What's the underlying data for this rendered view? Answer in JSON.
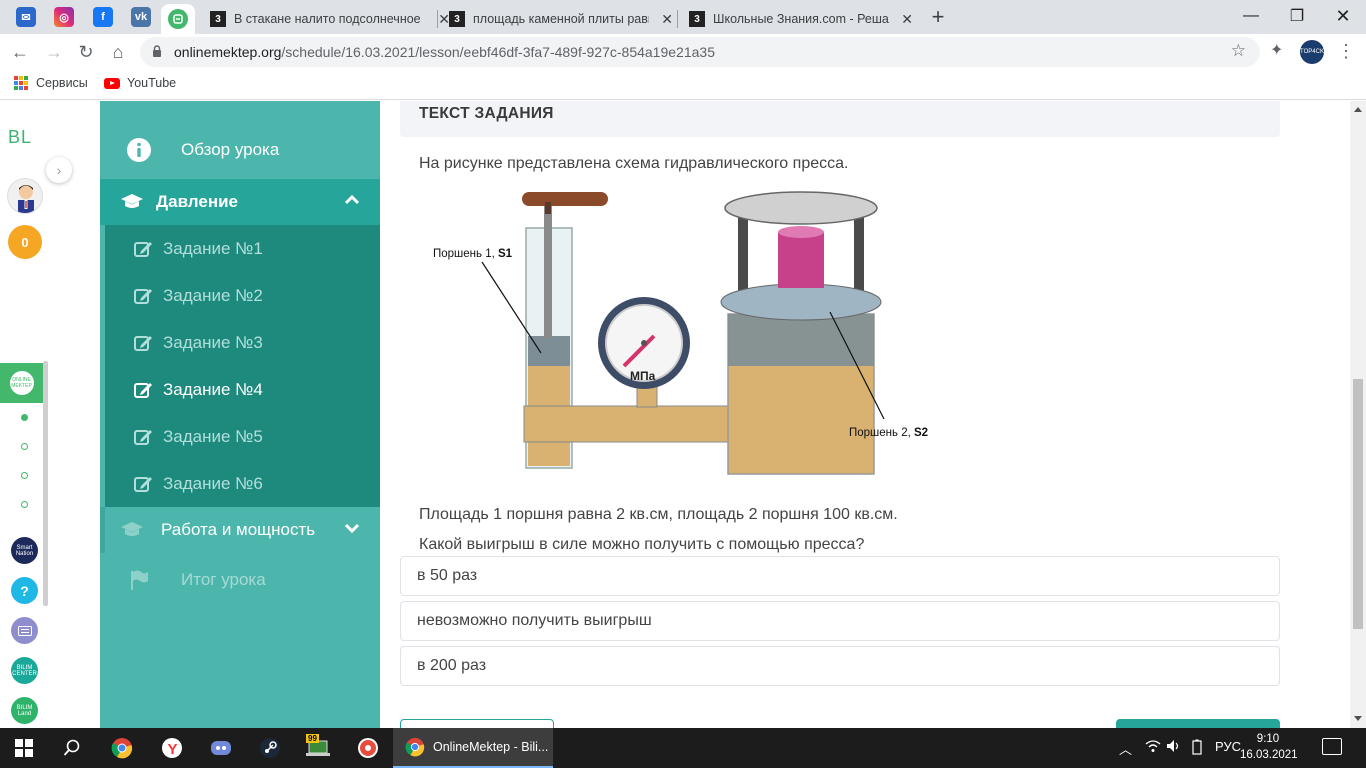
{
  "browser": {
    "tabs": [
      {
        "title": "В стакане налито подсолнечное"
      },
      {
        "title": "площадь каменной плиты равна"
      },
      {
        "title": "Школьные Знания.com - Решаем"
      }
    ],
    "url_host": "onlinemektep.org",
    "url_path": "/schedule/16.03.2021/lesson/eebf46df-3fa7-489f-927c-854a19e21a35",
    "bookmarks": [
      {
        "label": "Сервисы"
      },
      {
        "label": "YouTube"
      }
    ],
    "profile_text": "TOP4CK"
  },
  "rail": {
    "logo": "BL",
    "coins": "0",
    "app_label": "ONLINE MEKTEP",
    "smart_label": "Smart Nation",
    "help_label": "?",
    "bilim_label": "BILIM CENTER",
    "bilimland_label": "BILIM Land"
  },
  "sidebar": {
    "overview": "Обзор урока",
    "topic1": "Давление",
    "tasks": [
      "Задание №1",
      "Задание №2",
      "Задание №3",
      "Задание №4",
      "Задание №5",
      "Задание №6"
    ],
    "active_task": 3,
    "topic2": "Работа и мощность",
    "result": "Итог урока"
  },
  "content": {
    "header": "ТЕКСТ ЗАДАНИЯ",
    "intro": "На рисунке представлена схема гидравлического пресса.",
    "figure": {
      "piston1": "Поршень 1,",
      "piston1_s": "S1",
      "piston2": "Поршень 2,",
      "piston2_s": "S2",
      "gauge_unit": "МПа"
    },
    "line1": "Площадь 1 поршня равна 2 кв.см, площадь 2 поршня 100 кв.см.",
    "line2": "Какой выигрыш в силе можно получить с помощью пресса?",
    "answers": [
      "в 50 раз",
      "невозможно получить выигрыш",
      "в 200 раз"
    ]
  },
  "taskbar": {
    "active_window": "OnlineMektep - Bili...",
    "steam_badge": "99",
    "language": "РУС",
    "time": "9:10",
    "date": "16.03.2021"
  },
  "colors": {
    "sidebar": "#4db6ac",
    "sidebar_active": "#26a69a",
    "sidebar_tasks": "#1e8a7e",
    "accent_green": "#43b86c",
    "coin": "#f5a623"
  }
}
